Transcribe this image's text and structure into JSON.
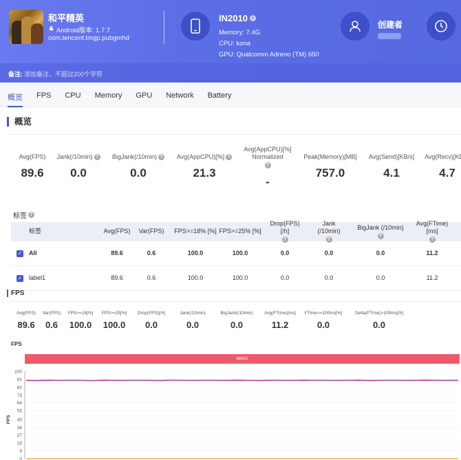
{
  "app": {
    "name": "和平精英",
    "android_version": "Android版本: 1.7.7",
    "package": "com.tencent.tmgp.pubgmhd"
  },
  "device": {
    "name": "IN2010",
    "memory": "Memory: 7.4G",
    "cpu": "CPU: kona",
    "gpu": "GPU: Qualcomm Adreno (TM) 650"
  },
  "creator": {
    "label": "创建者"
  },
  "remark": {
    "label": "备注:",
    "placeholder": "添加备注，不超过200个字符"
  },
  "tabs": [
    "概览",
    "FPS",
    "CPU",
    "Memory",
    "GPU",
    "Network",
    "Battery"
  ],
  "overview": {
    "title": "概览",
    "stats": [
      {
        "label": "Avg(FPS)",
        "value": "89.6",
        "help": false
      },
      {
        "label": "Jank(/10min)",
        "value": "0.0",
        "help": true
      },
      {
        "label": "BigJank(/10min)",
        "value": "0.0",
        "help": true
      },
      {
        "label": "Avg(AppCPU)[%]",
        "value": "21.3",
        "help": true
      },
      {
        "label": "Avg(AppCPU)[%] Normalized",
        "value": "-",
        "help": true
      },
      {
        "label": "Peak(Memory)[MB]",
        "value": "757.0",
        "help": false
      },
      {
        "label": "Avg(Send)[KB/s]",
        "value": "4.1",
        "help": false
      },
      {
        "label": "Avg(Recv)[KB/s]",
        "value": "4.7",
        "help": false
      }
    ]
  },
  "tags": {
    "title": "标签",
    "columns": [
      "标签",
      "Avg(FPS)",
      "Var(FPS)",
      "FPS>=18% [%]",
      "FPS>=25% [%]",
      "Drop(FPS) [/h]",
      "Jank (/10min)",
      "BigJank (/10min)",
      "Avg(FTime) [ms]"
    ],
    "rows": [
      {
        "label": "All",
        "cells": [
          "89.6",
          "0.6",
          "100.0",
          "100.0",
          "0.0",
          "0.0",
          "0.0",
          "11.2"
        ]
      },
      {
        "label": "label1",
        "cells": [
          "89.6",
          "0.6",
          "100.0",
          "100.0",
          "0.0",
          "0.0",
          "0.0",
          "11.2"
        ]
      }
    ]
  },
  "fps_section": {
    "title": "FPS",
    "stats": [
      {
        "label": "Avg(FPS)",
        "value": "89.6"
      },
      {
        "label": "Var(FPS)",
        "value": "0.6"
      },
      {
        "label": "FPS>=18[%]",
        "value": "100.0"
      },
      {
        "label": "FPS>=25[%]",
        "value": "100.0"
      },
      {
        "label": "Drop(FPS)[/h]",
        "value": "0.0"
      },
      {
        "label": "Jank(/10min)",
        "value": "0.0"
      },
      {
        "label": "BigJank(/10min)",
        "value": "0.0"
      },
      {
        "label": "Avg(FTime)[ms]",
        "value": "11.2"
      },
      {
        "label": "FTime>=100ms[%]",
        "value": "0.0"
      },
      {
        "label": "Delta(FTime)>100ms[/h]",
        "value": "0.0"
      }
    ]
  },
  "chart_data": {
    "type": "line",
    "title": "FPS",
    "ylabel": "FPS",
    "band_label": "label1",
    "ylim": [
      0,
      100
    ],
    "yticks": [
      100,
      91,
      82,
      73,
      64,
      55,
      45,
      36,
      27,
      18,
      9,
      0
    ],
    "series": [
      {
        "name": "",
        "color": "#b0309a",
        "values": [
          89.6,
          89.4,
          89.8,
          89.5,
          89.7,
          89.6,
          89.3,
          89.8,
          89.6,
          89.5,
          89.7,
          89.6,
          89.4,
          89.8,
          89.6,
          89.5,
          89.7,
          89.6,
          89.5,
          89.8,
          89.6,
          89.4,
          89.7,
          89.6,
          89.5,
          89.8,
          89.6,
          89.7,
          89.5,
          89.6,
          89.8,
          89.4,
          89.6,
          89.7,
          89.5,
          89.6,
          89.8,
          89.6,
          89.5,
          89.7
        ]
      },
      {
        "name": "",
        "color": "#f0a030",
        "values": [
          0,
          0,
          0,
          0,
          0,
          0,
          0,
          0,
          0,
          0,
          0,
          0,
          0,
          0,
          0,
          0,
          0,
          0,
          0,
          0,
          0,
          0,
          0,
          0,
          0,
          0,
          0,
          0,
          0,
          0,
          0,
          0,
          0,
          0,
          0,
          0,
          0,
          0,
          0,
          0
        ]
      }
    ]
  }
}
